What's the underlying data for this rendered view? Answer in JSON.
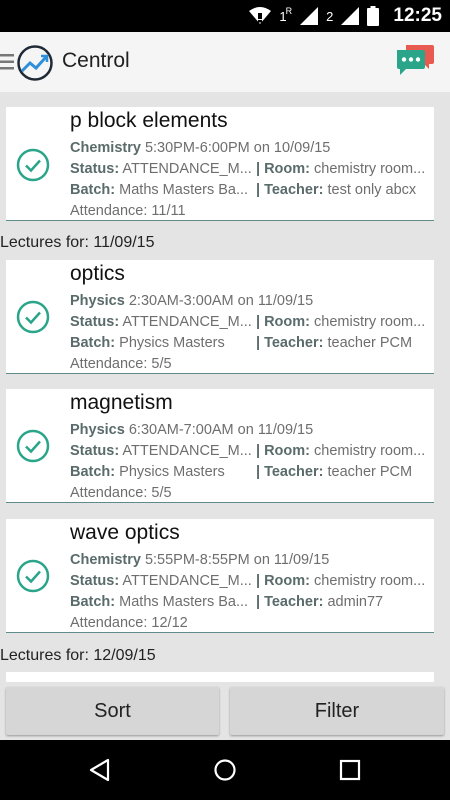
{
  "status_bar": {
    "time": "12:25",
    "sim1_label": "1",
    "sim1_roaming": "R",
    "sim2_label": "2"
  },
  "app_bar": {
    "title": "Centrol"
  },
  "colors": {
    "accent": "#2aa58a",
    "card_divider": "#5f8b8b",
    "chat_primary": "#2aa58a",
    "chat_secondary": "#e85a4f"
  },
  "cards": [
    {
      "title": "p block elements",
      "subject": "Chemistry",
      "time": "5:30PM-6:00PM on 10/09/15",
      "status_label": "Status:",
      "status": "ATTENDANCE_M...",
      "room_label": "| Room:",
      "room": "chemistry room...",
      "batch_label": "Batch:",
      "batch": "Maths Masters Ba...",
      "teacher_label": "| Teacher:",
      "teacher": "test only abcx",
      "attendance": "Attendance: 11/11"
    },
    {
      "title": "optics",
      "subject": "Physics",
      "time": "2:30AM-3:00AM on 11/09/15",
      "status_label": "Status:",
      "status": "ATTENDANCE_M...",
      "room_label": "| Room:",
      "room": "chemistry room...",
      "batch_label": "Batch:",
      "batch": "Physics Masters",
      "teacher_label": "| Teacher:",
      "teacher": "teacher PCM",
      "attendance": "Attendance: 5/5"
    },
    {
      "title": "magnetism",
      "subject": "Physics",
      "time": "6:30AM-7:00AM on 11/09/15",
      "status_label": "Status:",
      "status": "ATTENDANCE_M...",
      "room_label": "| Room:",
      "room": "chemistry room...",
      "batch_label": "Batch:",
      "batch": "Physics Masters",
      "teacher_label": "| Teacher:",
      "teacher": "teacher PCM",
      "attendance": "Attendance: 5/5"
    },
    {
      "title": "wave optics",
      "subject": "Chemistry",
      "time": "5:55PM-8:55PM on 11/09/15",
      "status_label": "Status:",
      "status": "ATTENDANCE_M...",
      "room_label": "| Room:",
      "room": "chemistry room...",
      "batch_label": "Batch:",
      "batch": "Maths Masters Ba...",
      "teacher_label": "| Teacher:",
      "teacher": "admin77",
      "attendance": "Attendance: 12/12"
    }
  ],
  "section_headers": [
    "Lectures for: 11/09/15",
    "Lectures for: 12/09/15"
  ],
  "actions": {
    "sort_label": "Sort",
    "filter_label": "Filter"
  }
}
